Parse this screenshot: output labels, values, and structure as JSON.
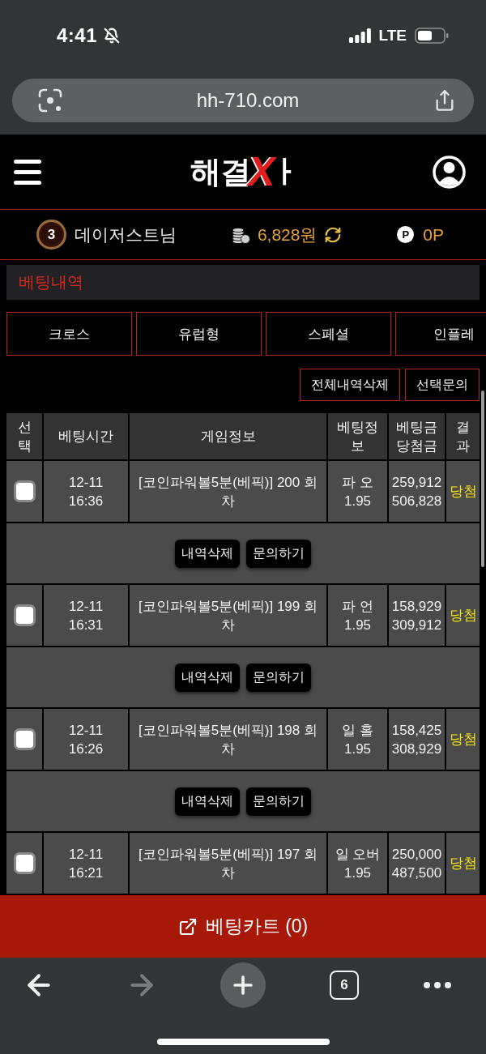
{
  "status_bar": {
    "time": "4:41",
    "network": "LTE"
  },
  "address_bar": {
    "url": "hh-710.com"
  },
  "header": {
    "logo": {
      "text": "해결",
      "mark": "X",
      "tail": "ㅏ"
    }
  },
  "user_bar": {
    "level": "3",
    "name": "데이저스트님",
    "balance": "6,828원",
    "points_badge": "P",
    "points": "0P"
  },
  "section_title": "베팅내역",
  "tabs": [
    {
      "label": "크로스",
      "selected": false
    },
    {
      "label": "유럽형",
      "selected": false
    },
    {
      "label": "스페셜",
      "selected": false
    },
    {
      "label": "인플레",
      "selected": false
    }
  ],
  "actions": [
    "전체내역삭제",
    "선택문의"
  ],
  "table": {
    "columns": [
      "선택",
      "베팅시간",
      "게임정보",
      "베팅정보",
      "베팅금 당첨금",
      "결과"
    ],
    "rows": [
      {
        "checked": false,
        "date": "12-11",
        "time": "16:36",
        "game": "[코인파워볼5분(베픽)] 200 회차",
        "pick": "파 오",
        "odds": "1.95",
        "stake": "259,912",
        "payout": "506,828",
        "result": "당첨",
        "buttons": [
          "내역삭제",
          "문의하기"
        ]
      },
      {
        "checked": false,
        "date": "12-11",
        "time": "16:31",
        "game": "[코인파워볼5분(베픽)] 199 회차",
        "pick": "파 언",
        "odds": "1.95",
        "stake": "158,929",
        "payout": "309,912",
        "result": "당첨",
        "buttons": [
          "내역삭제",
          "문의하기"
        ]
      },
      {
        "checked": false,
        "date": "12-11",
        "time": "16:26",
        "game": "[코인파워볼5분(베픽)] 198 회차",
        "pick": "일 홀",
        "odds": "1.95",
        "stake": "158,425",
        "payout": "308,929",
        "result": "당첨",
        "buttons": [
          "내역삭제",
          "문의하기"
        ]
      },
      {
        "checked": false,
        "date": "12-11",
        "time": "16:21",
        "game": "[코인파워볼5분(베픽)] 197 회차",
        "pick": "일 오버",
        "odds": "1.95",
        "stake": "250,000",
        "payout": "487,500",
        "result": "당첨"
      }
    ]
  },
  "bet_cart": {
    "label": "베팅카트 (0)"
  },
  "browser_toolbar": {
    "buttons": [
      {
        "kind": "back",
        "disabled": false
      },
      {
        "kind": "forward",
        "disabled": true
      },
      {
        "kind": "new_tab",
        "disabled": false
      },
      {
        "kind": "tabs",
        "label": "6",
        "disabled": false
      },
      {
        "kind": "more",
        "disabled": false
      }
    ]
  }
}
